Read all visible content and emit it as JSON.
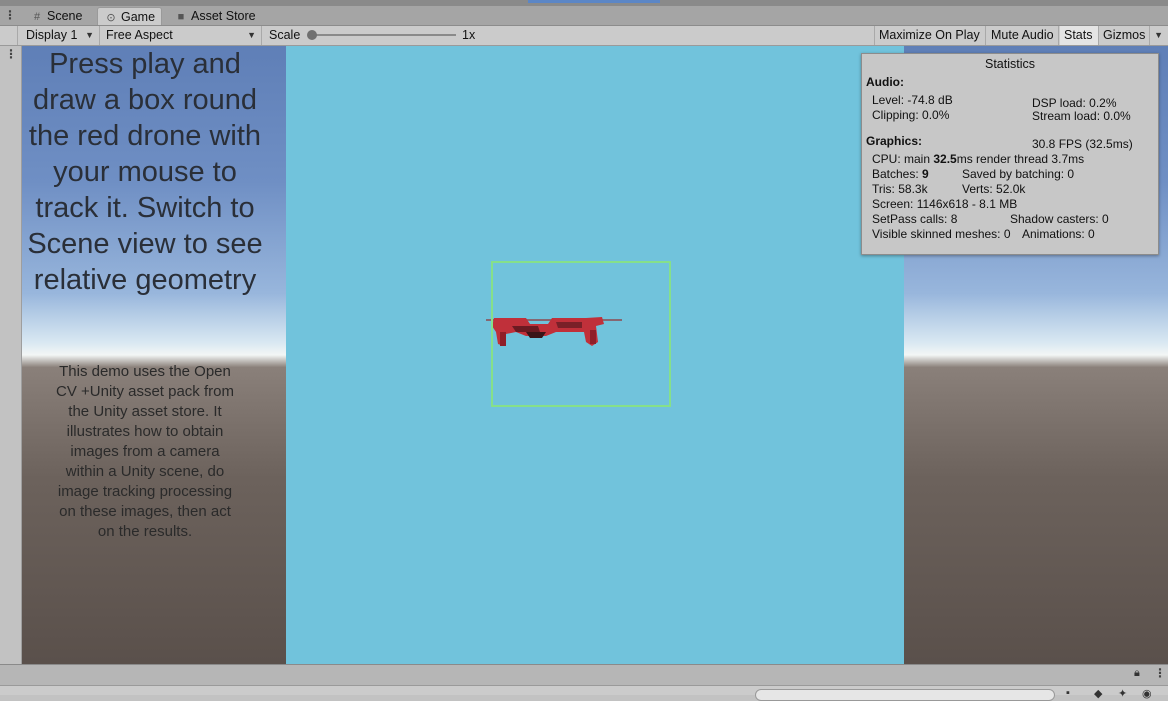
{
  "tabs": [
    {
      "label": "Scene",
      "icon": "grid-icon"
    },
    {
      "label": "Game",
      "icon": "gamepad-icon"
    },
    {
      "label": "Asset Store",
      "icon": "shopping-bag-icon"
    }
  ],
  "toolbar": {
    "display": "Display 1",
    "aspect": "Free Aspect",
    "scale_label": "Scale",
    "scale_value": "1x",
    "maximize_on_play": "Maximize On Play",
    "mute_audio": "Mute Audio",
    "stats": "Stats",
    "gizmos": "Gizmos"
  },
  "game": {
    "headline": "Press play and draw a box round the red drone with your mouse to track it. Switch to Scene view to see relative geometry",
    "description": "This demo uses the Open CV +Unity asset pack from the Unity asset store. It illustrates how to obtain images from a camera within a Unity scene, do image tracking processing on these images, then act on the results."
  },
  "stats": {
    "title": "Statistics",
    "audio_label": "Audio:",
    "level": "Level: -74.8 dB",
    "dsp_load": "DSP load: 0.2%",
    "clipping": "Clipping: 0.0%",
    "stream_load": "Stream load: 0.0%",
    "graphics_label": "Graphics:",
    "fps": "30.8 FPS (32.5ms)",
    "cpu_main_label": "CPU: main ",
    "cpu_main_value": "32.5",
    "cpu_main_unit": "ms  render thread 3.7ms",
    "batches_label": "Batches: ",
    "batches_value": "9",
    "saved_by_batching": "Saved by batching: 0",
    "tris": "Tris: 58.3k",
    "verts": "Verts: 52.0k",
    "screen": "Screen: 1146x618 - 8.1 MB",
    "setpass": "SetPass calls: 8",
    "shadow_casters": "Shadow casters: 0",
    "visible_skinned": "Visible skinned meshes: 0",
    "animations": "Animations: 0"
  },
  "colors": {
    "render_bg": "#71c3dc",
    "tracking_box": "#86e08a",
    "drone": "#c0303a"
  }
}
